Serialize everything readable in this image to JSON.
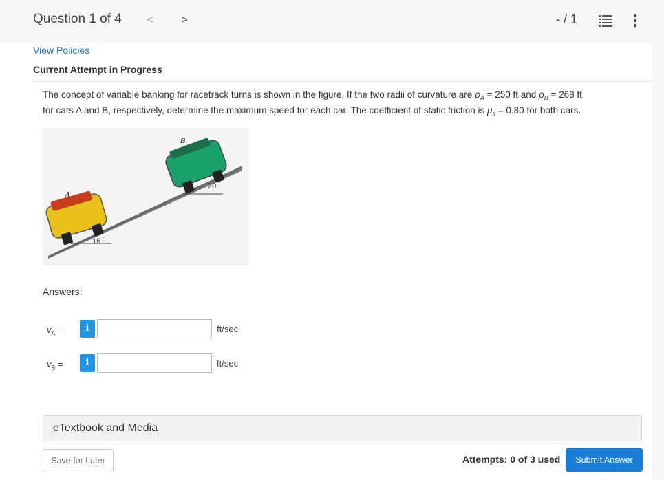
{
  "header": {
    "question_label": "Question 1 of 4",
    "prev_icon": "<",
    "next_icon": ">",
    "score": "- / 1",
    "list_icon": "list-icon",
    "more_icon": "more-vertical-icon"
  },
  "policies_link": "View Policies",
  "attempt_heading": "Current Attempt in Progress",
  "question": {
    "p1": "The concept of variable banking for racetrack turns is shown in the figure. If the two radii of curvature are ",
    "rho_a_sym": "ρ",
    "rho_a_sub": "A",
    "rho_a_val": " = 250 ft and ",
    "rho_b_sym": "ρ",
    "rho_b_sub": "B",
    "rho_b_val": " = 268 ft",
    "p2": "for cars A and B, respectively, determine the maximum speed for each car. The coefficient of static friction is ",
    "mu_sym": "μ",
    "mu_sub": "s",
    "mu_val": " = 0.80 for both cars."
  },
  "figure": {
    "car_a_label": "A",
    "car_b_label": "B",
    "angle_a": "16",
    "angle_b": "20",
    "degree": "°",
    "car_a_color": "#e8c21a",
    "car_b_color": "#1aa06a"
  },
  "answers_label": "Answers:",
  "answers": [
    {
      "var": "v",
      "sub": "A",
      "eq": " =",
      "info": "i",
      "value": "",
      "unit": "ft/sec"
    },
    {
      "var": "v",
      "sub": "B",
      "eq": " =",
      "info": "i",
      "value": "",
      "unit": "ft/sec"
    }
  ],
  "etextbook_label": "eTextbook and Media",
  "save_label": "Save for Later",
  "attempts_text": "Attempts: 0 of 3 used",
  "submit_label": "Submit Answer",
  "colors": {
    "accent": "#1a7ed6",
    "info": "#2196e6",
    "link": "#1a73c8"
  }
}
